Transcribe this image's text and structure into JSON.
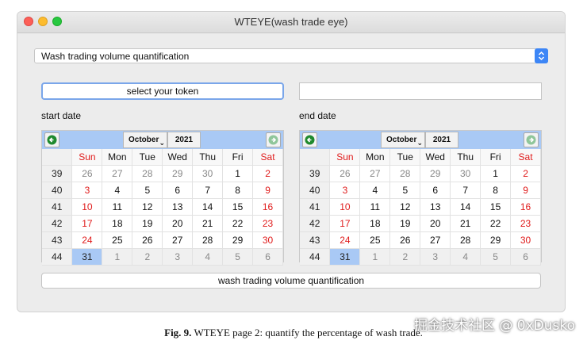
{
  "window": {
    "title": "WTEYE(wash trade eye)"
  },
  "mode_select": {
    "value": "Wash trading volume quantification"
  },
  "token_button": {
    "label": "select your token"
  },
  "token_field": {
    "value": ""
  },
  "start": {
    "label": "start date",
    "month": "October",
    "year": "2021",
    "weekdays": [
      "Sun",
      "Mon",
      "Tue",
      "Wed",
      "Thu",
      "Fri",
      "Sat"
    ],
    "weeks": [
      {
        "num": "39",
        "days": [
          "26",
          "27",
          "28",
          "29",
          "30",
          "1",
          "2"
        ]
      },
      {
        "num": "40",
        "days": [
          "3",
          "4",
          "5",
          "6",
          "7",
          "8",
          "9"
        ]
      },
      {
        "num": "41",
        "days": [
          "10",
          "11",
          "12",
          "13",
          "14",
          "15",
          "16"
        ]
      },
      {
        "num": "42",
        "days": [
          "17",
          "18",
          "19",
          "20",
          "21",
          "22",
          "23"
        ]
      },
      {
        "num": "43",
        "days": [
          "24",
          "25",
          "26",
          "27",
          "28",
          "29",
          "30"
        ]
      },
      {
        "num": "44",
        "days": [
          "31",
          "1",
          "2",
          "3",
          "4",
          "5",
          "6"
        ]
      }
    ],
    "selected": "31"
  },
  "end": {
    "label": "end date",
    "month": "October",
    "year": "2021",
    "weekdays": [
      "Sun",
      "Mon",
      "Tue",
      "Wed",
      "Thu",
      "Fri",
      "Sat"
    ],
    "weeks": [
      {
        "num": "39",
        "days": [
          "26",
          "27",
          "28",
          "29",
          "30",
          "1",
          "2"
        ]
      },
      {
        "num": "40",
        "days": [
          "3",
          "4",
          "5",
          "6",
          "7",
          "8",
          "9"
        ]
      },
      {
        "num": "41",
        "days": [
          "10",
          "11",
          "12",
          "13",
          "14",
          "15",
          "16"
        ]
      },
      {
        "num": "42",
        "days": [
          "17",
          "18",
          "19",
          "20",
          "21",
          "22",
          "23"
        ]
      },
      {
        "num": "43",
        "days": [
          "24",
          "25",
          "26",
          "27",
          "28",
          "29",
          "30"
        ]
      },
      {
        "num": "44",
        "days": [
          "31",
          "1",
          "2",
          "3",
          "4",
          "5",
          "6"
        ]
      }
    ],
    "selected": "31"
  },
  "action_button": {
    "label": "wash trading volume quantification"
  },
  "caption": {
    "fig": "Fig. 9.",
    "text": "WTEYE page 2: quantify the percentage of wash trade."
  },
  "watermark": "掘金技术社区 @ 0xDusko",
  "colors": {
    "weekend": "#e01b1b",
    "header": "#a9c9f5",
    "accent": "#3d86f6"
  }
}
